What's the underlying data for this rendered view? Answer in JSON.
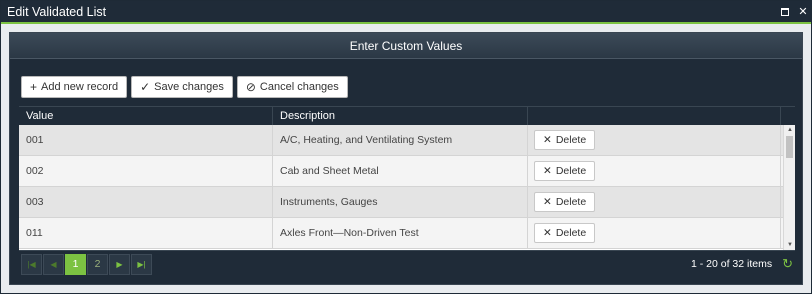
{
  "window": {
    "title": "Edit Validated List",
    "maximize_icon": "maximize-icon",
    "close_icon": "close-icon",
    "close_glyph": "✕"
  },
  "panel": {
    "header": "Enter Custom Values"
  },
  "toolbar": {
    "add_label": "Add new record",
    "save_label": "Save changes",
    "cancel_label": "Cancel changes"
  },
  "columns": [
    "Value",
    "Description",
    ""
  ],
  "rows": [
    {
      "value": "001",
      "description": "A/C, Heating, and Ventilating System",
      "action": "Delete"
    },
    {
      "value": "002",
      "description": "Cab and Sheet Metal",
      "action": "Delete"
    },
    {
      "value": "003",
      "description": "Instruments, Gauges",
      "action": "Delete"
    },
    {
      "value": "011",
      "description": "Axles Front—Non-Driven Test",
      "action": "Delete"
    }
  ],
  "pager": {
    "pages": [
      "1",
      "2"
    ],
    "current_page": "1",
    "info": "1 - 20 of 32 items"
  },
  "colors": {
    "accent": "#7cc242",
    "header_bg": "#1f2b38"
  }
}
